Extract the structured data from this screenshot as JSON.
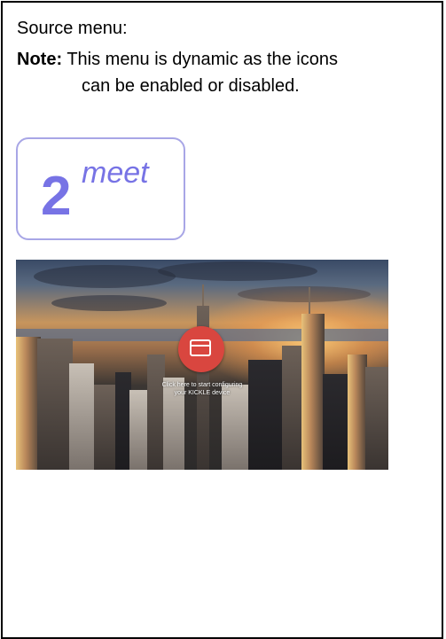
{
  "heading": "Source menu:",
  "note": {
    "label": "Note:",
    "line1": "This menu is dynamic as the icons",
    "line2": "can be enabled or disabled."
  },
  "logo": {
    "number": "2",
    "word": "meet",
    "color": "#7773e5"
  },
  "screen": {
    "action_icon": "window-icon",
    "action_color": "#d9463f",
    "caption_line1": "Click here to start configuring",
    "caption_line2": "your KICKLE device"
  }
}
